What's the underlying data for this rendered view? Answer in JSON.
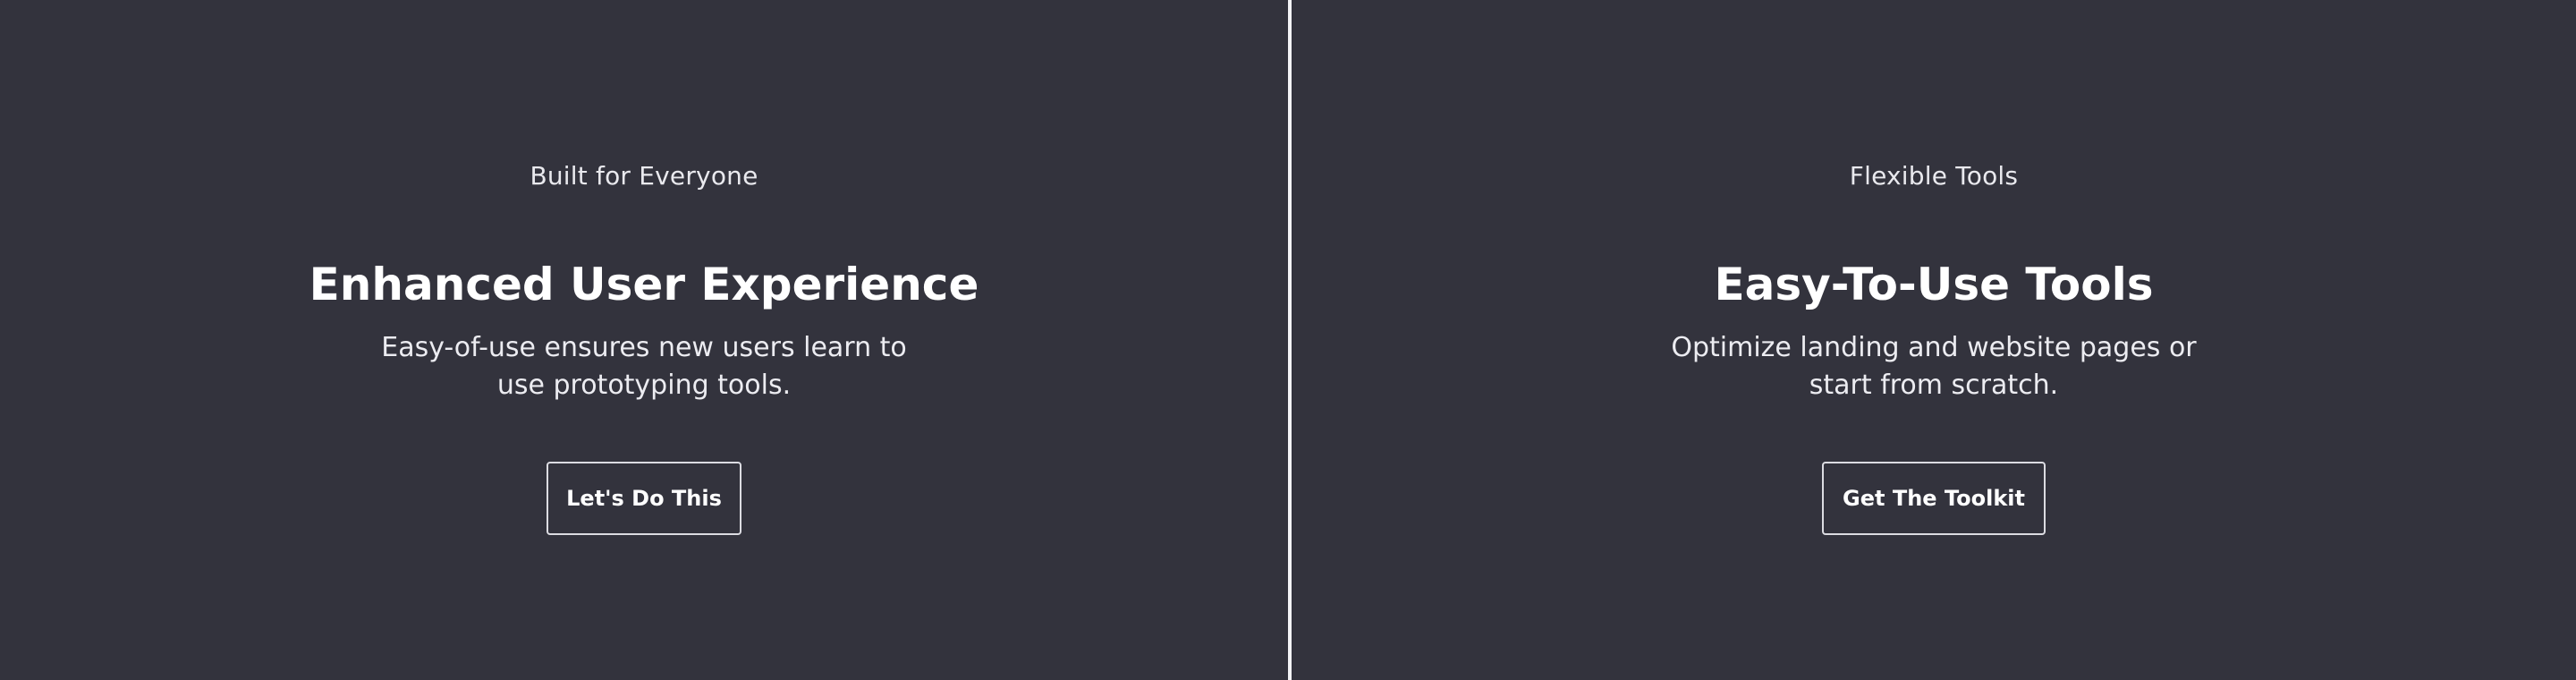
{
  "panels": [
    {
      "eyebrow": "Built for Everyone",
      "title": "Enhanced User Experience",
      "description": "Easy-of-use ensures new users learn to use prototyping tools.",
      "button_label": "Let's Do This"
    },
    {
      "eyebrow": "Flexible Tools",
      "title": "Easy-To-Use Tools",
      "description": "Optimize landing and website pages or start from scratch.",
      "button_label": "Get The Toolkit"
    }
  ],
  "colors": {
    "background": "#33333d",
    "divider": "#f4f4f7",
    "text": "#ffffff",
    "button_border": "#dcdce2"
  }
}
